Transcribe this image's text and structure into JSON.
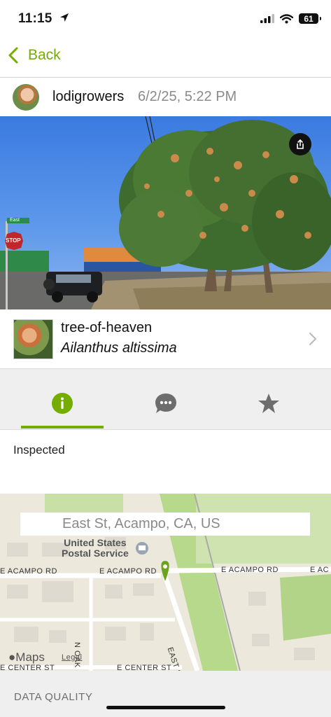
{
  "status": {
    "time": "11:15",
    "battery": "61"
  },
  "nav": {
    "back_label": "Back"
  },
  "observation": {
    "username": "lodigrowers",
    "date": "6/2/25, 5:22 PM",
    "common_name": "tree-of-heaven",
    "scientific_name": "Ailanthus altissima",
    "description": "Inspected"
  },
  "photo_signs": {
    "street": "East",
    "stop": "STOP"
  },
  "map": {
    "location": "East St, Acampo, CA, US",
    "poi": "United States\nPostal Service",
    "roads": {
      "acampo_left": "E ACAMPO RD",
      "acampo_mid": "E ACAMPO RD",
      "acampo_right": "E ACAMPO RD",
      "acampo_far": "E AC",
      "oak": "N OAK ST",
      "east": "EAST ST",
      "center_left": "E CENTER ST",
      "center_mid": "E CENTER ST"
    },
    "attribution": "Maps",
    "legal": "Legal"
  },
  "sections": {
    "data_quality": "DATA QUALITY"
  },
  "colors": {
    "accent": "#74ac00",
    "icon_gray": "#6d6d6d"
  }
}
